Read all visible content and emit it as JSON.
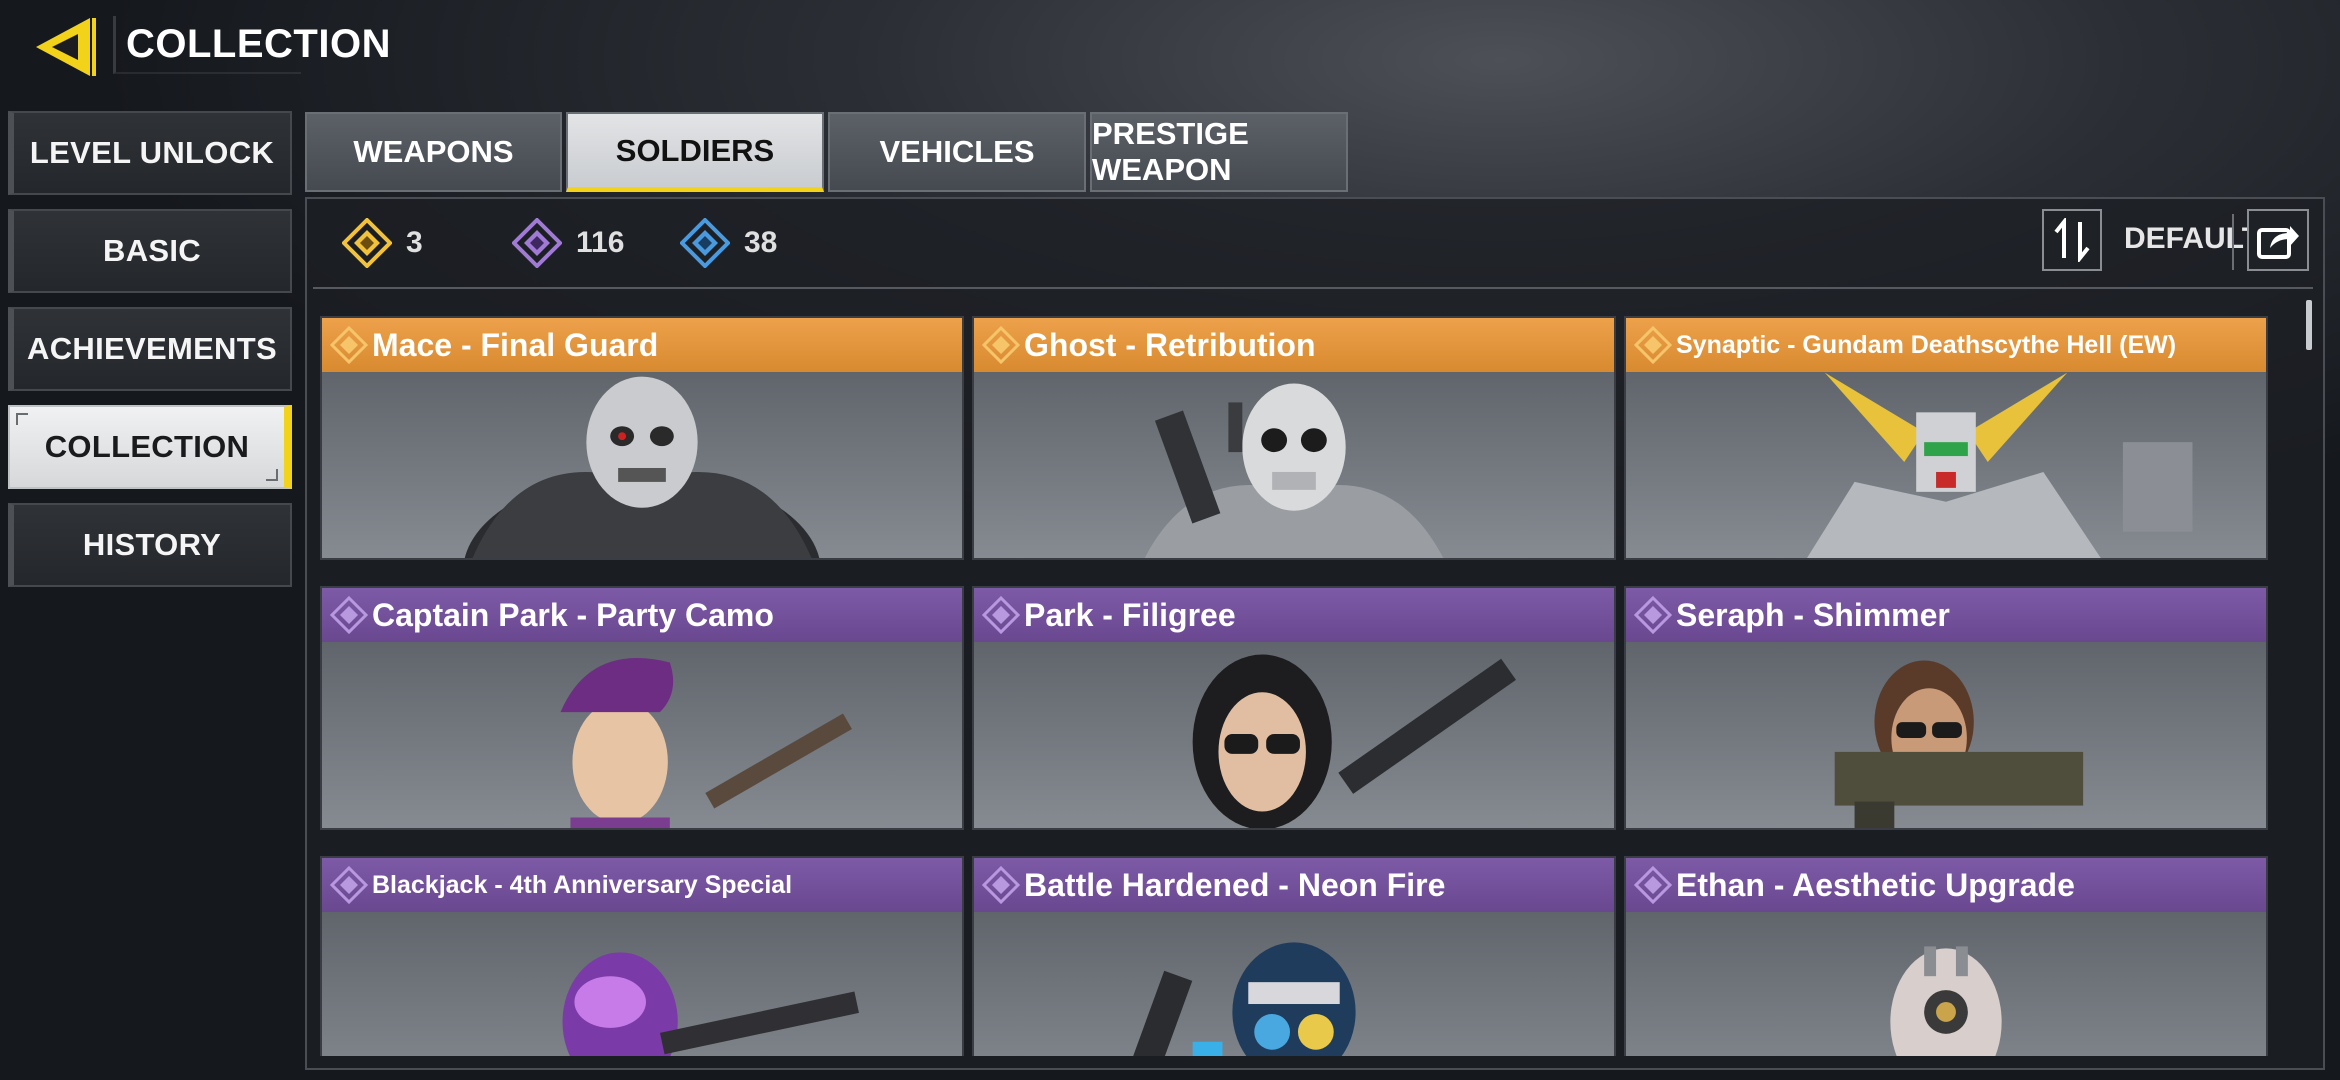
{
  "header": {
    "title": "COLLECTION"
  },
  "sidebar": {
    "items": [
      {
        "label": "LEVEL UNLOCK"
      },
      {
        "label": "BASIC"
      },
      {
        "label": "ACHIEVEMENTS"
      },
      {
        "label": "COLLECTION",
        "active": true
      },
      {
        "label": "HISTORY"
      }
    ]
  },
  "tabs": [
    {
      "label": "WEAPONS"
    },
    {
      "label": "SOLDIERS",
      "active": true
    },
    {
      "label": "VEHICLES"
    },
    {
      "label": "PRESTIGE WEAPON"
    }
  ],
  "currencies": [
    {
      "icon": "legendary-rarity-icon",
      "color": "#f2c23a",
      "value": "3"
    },
    {
      "icon": "epic-rarity-icon",
      "color": "#a07ad4",
      "value": "116"
    },
    {
      "icon": "rare-rarity-icon",
      "color": "#4a9ae0",
      "value": "38"
    }
  ],
  "sort": {
    "label": "DEFAULT"
  },
  "colors": {
    "accent": "#f3d21a",
    "legendary": "#e3953c",
    "epic": "#72509a"
  },
  "cards": [
    {
      "title": "Mace - Final Guard",
      "rarity": "legendary"
    },
    {
      "title": "Ghost - Retribution",
      "rarity": "legendary"
    },
    {
      "title": "Synaptic - Gundam Deathscythe Hell (EW)",
      "rarity": "legendary",
      "art_watermark": "Gundam"
    },
    {
      "title": "Captain Park - Party Camo",
      "rarity": "epic"
    },
    {
      "title": "Park - Filigree",
      "rarity": "epic"
    },
    {
      "title": "Seraph - Shimmer",
      "rarity": "epic"
    },
    {
      "title": "Blackjack - 4th Anniversary Special",
      "rarity": "epic"
    },
    {
      "title": "Battle Hardened - Neon Fire",
      "rarity": "epic"
    },
    {
      "title": "Ethan - Aesthetic Upgrade",
      "rarity": "epic"
    }
  ]
}
